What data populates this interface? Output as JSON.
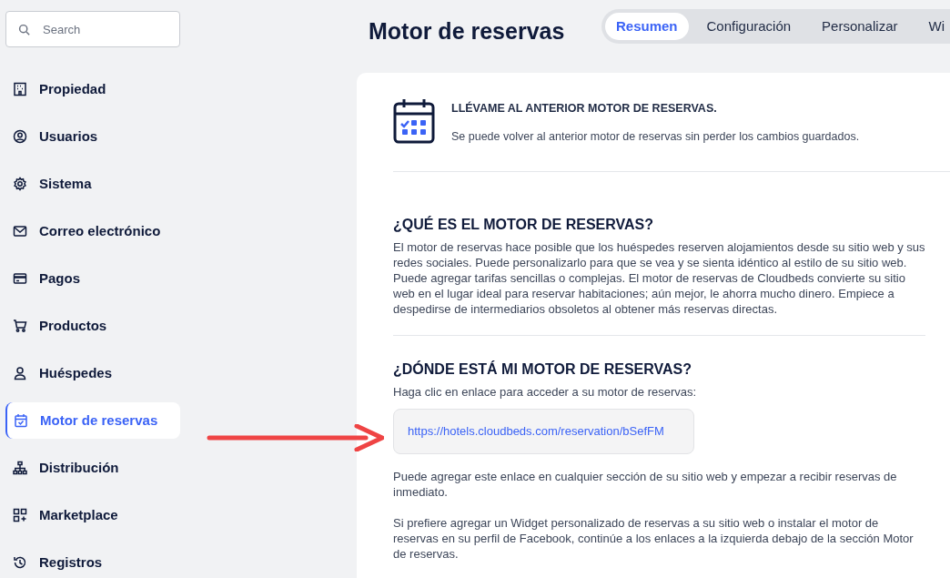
{
  "search": {
    "placeholder": "Search"
  },
  "sidebar": {
    "items": [
      {
        "label": "Propiedad",
        "selected": false
      },
      {
        "label": "Usuarios",
        "selected": false
      },
      {
        "label": "Sistema",
        "selected": false
      },
      {
        "label": "Correo electrónico",
        "selected": false
      },
      {
        "label": "Pagos",
        "selected": false
      },
      {
        "label": "Productos",
        "selected": false
      },
      {
        "label": "Huéspedes",
        "selected": false
      },
      {
        "label": "Motor de reservas",
        "selected": true
      },
      {
        "label": "Distribución",
        "selected": false
      },
      {
        "label": "Marketplace",
        "selected": false
      },
      {
        "label": "Registros",
        "selected": false
      }
    ]
  },
  "page_title": "Motor de reservas",
  "tabs": [
    {
      "label": "Resumen",
      "selected": true
    },
    {
      "label": "Configuración",
      "selected": false
    },
    {
      "label": "Personalizar",
      "selected": false
    },
    {
      "label": "Wi",
      "selected": false
    }
  ],
  "notice": {
    "title": "LLÉVAME AL ANTERIOR MOTOR DE RESERVAS.",
    "text": "Se puede volver al anterior motor de reservas sin perder los cambios guardados."
  },
  "sections": [
    {
      "heading": "¿QUÉ ES EL MOTOR DE RESERVAS?",
      "paragraphs": [
        "El motor de reservas hace posible que los huéspedes reserven alojamientos desde su sitio web y sus redes sociales. Puede personalizarlo para que se vea y se sienta idéntico al estilo de su sitio web. Puede agregar tarifas sencillas o complejas. El motor de reservas de Cloudbeds convierte su sitio web en el lugar ideal para reservar habitaciones; aún mejor, le ahorra mucho dinero. Empiece a despedirse de intermediarios obsoletos al obtener más reservas directas."
      ]
    },
    {
      "heading": "¿DÓNDE ESTÁ MI MOTOR DE RESERVAS?",
      "intro": "Haga clic en enlace para acceder a su motor de reservas:",
      "link": "https://hotels.cloudbeds.com/reservation/bSefFM",
      "paragraphs": [
        "Puede agregar este enlace en cualquier sección de su sitio web y empezar a recibir reservas de inmediato.",
        "Si prefiere agregar un Widget personalizado de reservas a su sitio web o instalar el motor de reservas en su perfil de Facebook, continúe a los enlaces a la izquierda debajo de la sección Motor de reservas."
      ]
    }
  ]
}
